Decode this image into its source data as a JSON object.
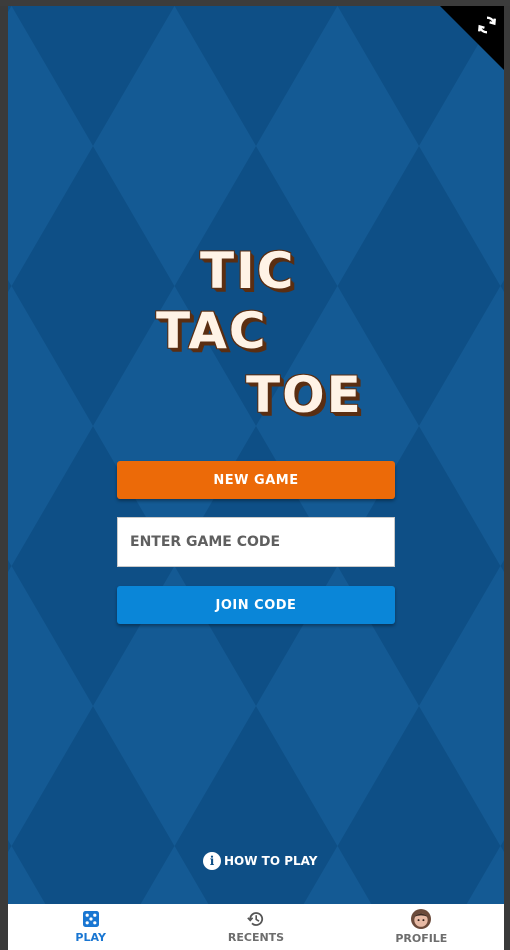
{
  "title": {
    "line1": "TIC",
    "line2": "TAC",
    "line3": "TOE"
  },
  "actions": {
    "new_game_label": "NEW GAME",
    "game_code_placeholder": "ENTER GAME CODE",
    "game_code_value": "",
    "join_code_label": "JOIN CODE"
  },
  "help": {
    "how_to_play_label": "HOW TO PLAY",
    "icon": "info-icon"
  },
  "corner": {
    "icon": "sync-icon"
  },
  "bottom_nav": {
    "items": [
      {
        "label": "PLAY",
        "icon": "dice-icon",
        "active": true
      },
      {
        "label": "RECENTS",
        "icon": "history-icon",
        "active": false
      },
      {
        "label": "PROFILE",
        "icon": "avatar-icon",
        "active": false
      }
    ]
  },
  "colors": {
    "background": "#0e4f86",
    "pattern": "#145a94",
    "new_game": "#ec6a08",
    "join_code": "#0a86d8",
    "nav_active": "#1976d2",
    "nav_inactive": "#6d6d6d",
    "title_fill": "#fff3e6",
    "title_outline": "#5a2e12"
  }
}
